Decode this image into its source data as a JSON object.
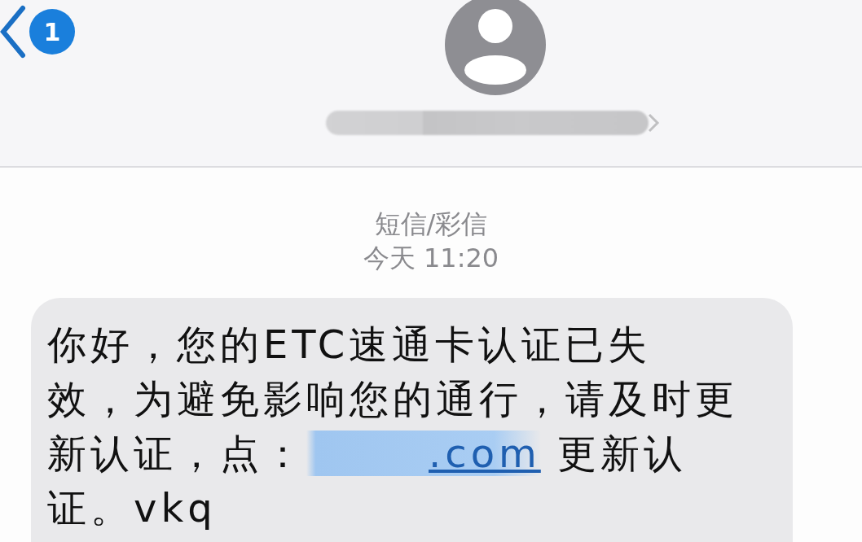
{
  "header": {
    "unread_count": "1"
  },
  "thread": {
    "service": "短信/彩信",
    "timestamp": "今天 11:20"
  },
  "message": {
    "lines": [
      {
        "text": "你好，您的ETC速通卡认证已失"
      },
      {
        "text": "效，为避免影响您的通行，请及时更"
      },
      {
        "text": "新认证，点：",
        "link": ".com",
        "text_after": " 更新认"
      },
      {
        "text": "证。vkq"
      }
    ]
  }
}
